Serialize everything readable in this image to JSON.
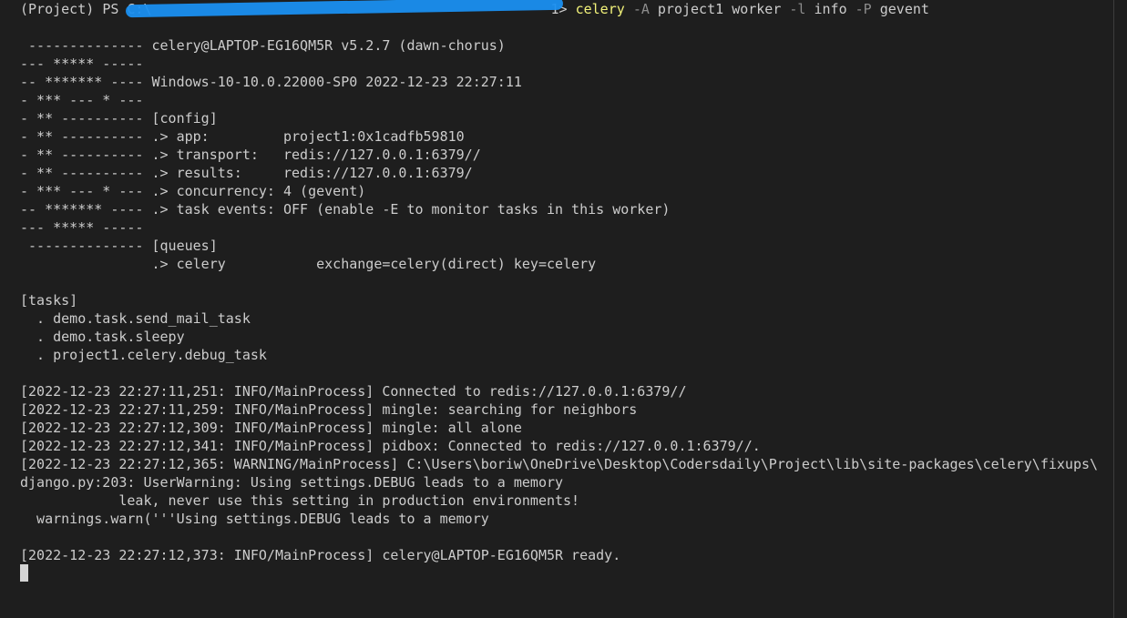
{
  "prompt": {
    "env": "(Project)",
    "shell": "PS",
    "path_visible": "C:\\",
    "path_tail": "1>",
    "command": "celery",
    "args": [
      {
        "text": "-A",
        "kind": "flag"
      },
      {
        "text": "project1",
        "kind": "arg"
      },
      {
        "text": "worker",
        "kind": "arg"
      },
      {
        "text": "-l",
        "kind": "flag"
      },
      {
        "text": "info",
        "kind": "arg"
      },
      {
        "text": "-P",
        "kind": "flag"
      },
      {
        "text": "gevent",
        "kind": "arg"
      }
    ]
  },
  "banner": [
    " -------------- celery@LAPTOP-EG16QM5R v5.2.7 (dawn-chorus)",
    "--- ***** -----",
    "-- ******* ---- Windows-10-10.0.22000-SP0 2022-12-23 22:27:11",
    "- *** --- * ---",
    "- ** ---------- [config]",
    "- ** ---------- .> app:         project1:0x1cadfb59810",
    "- ** ---------- .> transport:   redis://127.0.0.1:6379//",
    "- ** ---------- .> results:     redis://127.0.0.1:6379/",
    "- *** --- * --- .> concurrency: 4 (gevent)",
    "-- ******* ---- .> task events: OFF (enable -E to monitor tasks in this worker)",
    "--- ***** -----",
    " -------------- [queues]",
    "                .> celery           exchange=celery(direct) key=celery"
  ],
  "tasks_header": "[tasks]",
  "tasks": [
    "  . demo.task.send_mail_task",
    "  . demo.task.sleepy",
    "  . project1.celery.debug_task"
  ],
  "logs": [
    "[2022-12-23 22:27:11,251: INFO/MainProcess] Connected to redis://127.0.0.1:6379//",
    "[2022-12-23 22:27:11,259: INFO/MainProcess] mingle: searching for neighbors",
    "[2022-12-23 22:27:12,309: INFO/MainProcess] mingle: all alone",
    "[2022-12-23 22:27:12,341: INFO/MainProcess] pidbox: Connected to redis://127.0.0.1:6379//.",
    "[2022-12-23 22:27:12,365: WARNING/MainProcess] C:\\Users\\boriw\\OneDrive\\Desktop\\Codersdaily\\Project\\lib\\site-packages\\celery\\fixups\\",
    "django.py:203: UserWarning: Using settings.DEBUG leads to a memory",
    "            leak, never use this setting in production environments!",
    "  warnings.warn('''Using settings.DEBUG leads to a memory"
  ],
  "ready_line": "[2022-12-23 22:27:12,373: INFO/MainProcess] celery@LAPTOP-EG16QM5R ready.",
  "colors": {
    "background": "#1e1e1e",
    "text": "#cccccc",
    "command": "#f2f27a",
    "flag": "#8c8c8c",
    "redaction": "#1a8ff0"
  }
}
